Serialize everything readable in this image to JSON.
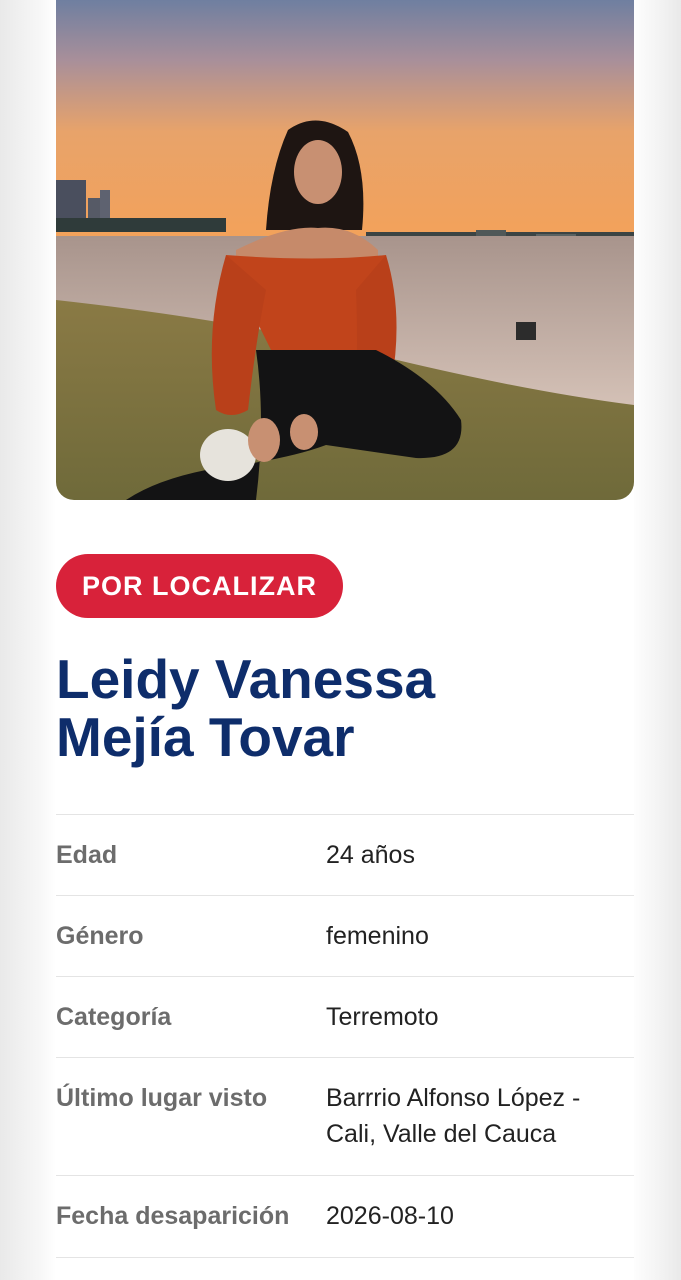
{
  "profile": {
    "photo_alt": "Photo of missing person",
    "status_label": "POR LOCALIZAR",
    "name_line1": "Leidy Vanessa",
    "name_line2": "Mejía Tovar"
  },
  "details": [
    {
      "label": "Edad",
      "value": "24 años"
    },
    {
      "label": "Género",
      "value": "femenino"
    },
    {
      "label": "Categoría",
      "value": "Terremoto"
    },
    {
      "label": "Último lugar visto",
      "value_line1": "Barrrio Alfonso López -",
      "value_line2": "Cali, Valle del Cauca"
    },
    {
      "label": "Fecha desaparición",
      "value": "2026-08-10"
    }
  ],
  "colors": {
    "status_red": "#d8223a",
    "name_navy": "#0e2d6b",
    "label_gray": "#6c6c6c"
  }
}
